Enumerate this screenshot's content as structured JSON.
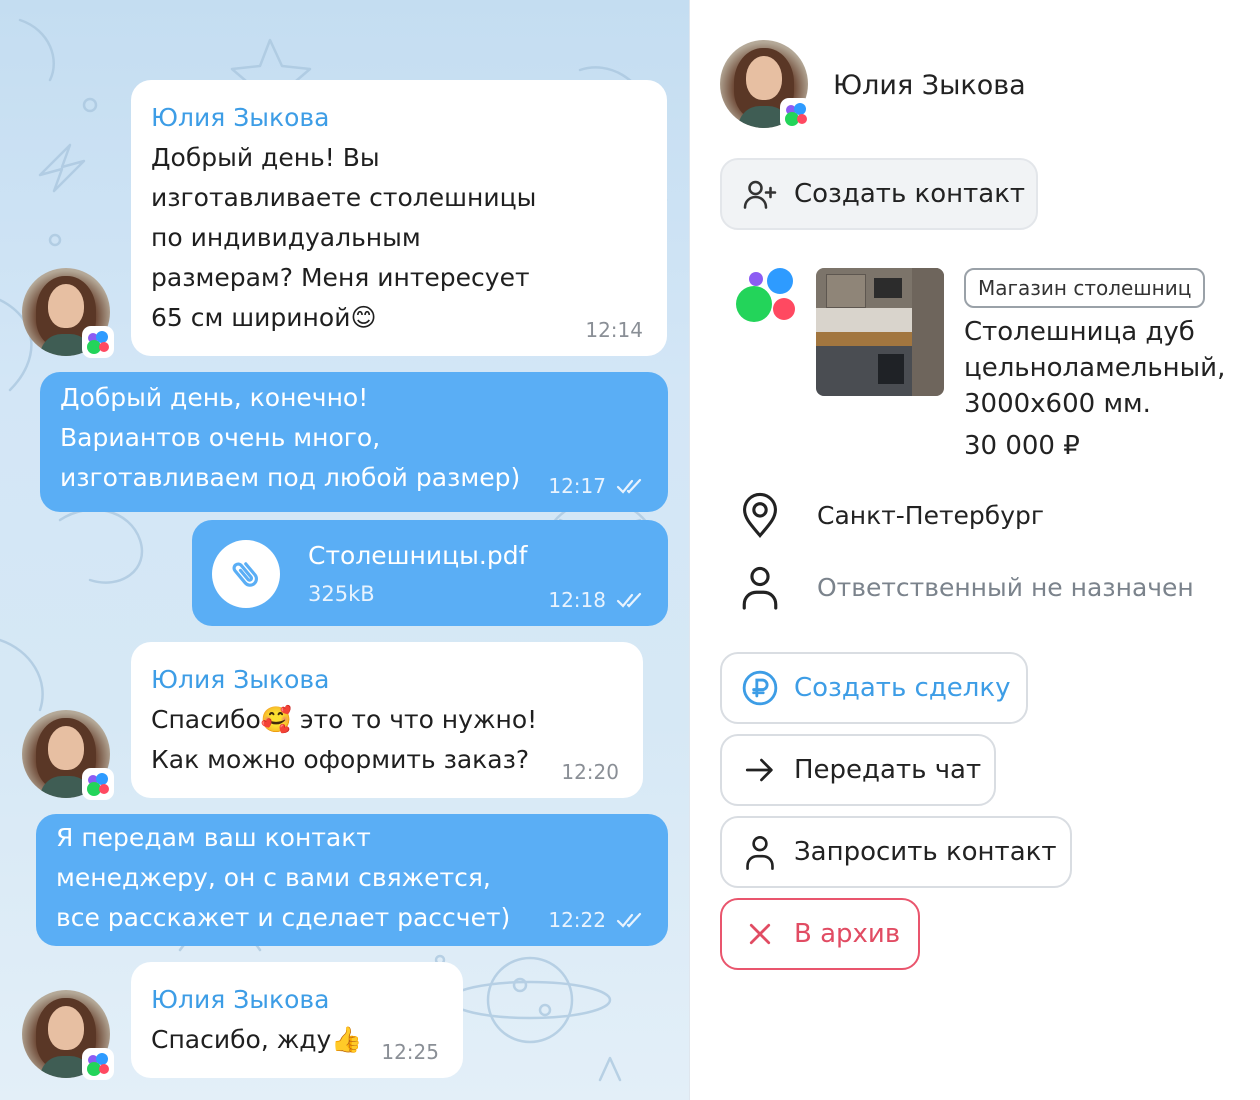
{
  "chat": {
    "messages": [
      {
        "direction": "in",
        "sender": "Юлия Зыкова",
        "text": "Добрый день! Вы\nизготавливаете столешницы\nпо индивидуальным\nразмерам? Меня интересует\n65 см шириной😊",
        "time": "12:14"
      },
      {
        "direction": "out",
        "text": "Добрый день, конечно!\nВариантов очень много,\nизготавливаем под любой размер)",
        "time": "12:17",
        "status": "read"
      },
      {
        "direction": "out",
        "file_name": "Столешницы.pdf",
        "file_size": "325kB",
        "time": "12:18",
        "status": "read",
        "icon": "paperclip-icon"
      },
      {
        "direction": "in",
        "sender": "Юлия Зыкова",
        "text": "Спасибо🥰 это то что нужно!\nКак можно оформить заказ?",
        "time": "12:20"
      },
      {
        "direction": "out",
        "text": "Я передам ваш контакт\nменеджеру, он с вами свяжется,\nвсе расскажет и сделает рассчет)",
        "time": "12:22",
        "status": "read"
      },
      {
        "direction": "in",
        "sender": "Юлия Зыкова",
        "text": "Спасибо, жду👍",
        "time": "12:25"
      }
    ]
  },
  "side": {
    "contact_name": "Юлия Зыкова",
    "create_contact": "Создать контакт",
    "product": {
      "tag": "Магазин столешниц",
      "title": "Столешница дуб\nцельноламельный,\n3000х600 мм.",
      "price": "30 000 ₽"
    },
    "city": "Санкт-Петербург",
    "responsible": "Ответственный не назначен",
    "actions": {
      "create_deal": "Создать сделку",
      "transfer_chat": "Передать чат",
      "request_contact": "Запросить контакт",
      "archive": "В архив"
    }
  },
  "colors": {
    "incoming_bubble": "#ffffff",
    "outgoing_bubble": "#5aaef5",
    "sender_name": "#3d9de6",
    "accent_blue": "#3d9de6",
    "danger": "#e14c63",
    "muted_text": "#7b838c"
  }
}
